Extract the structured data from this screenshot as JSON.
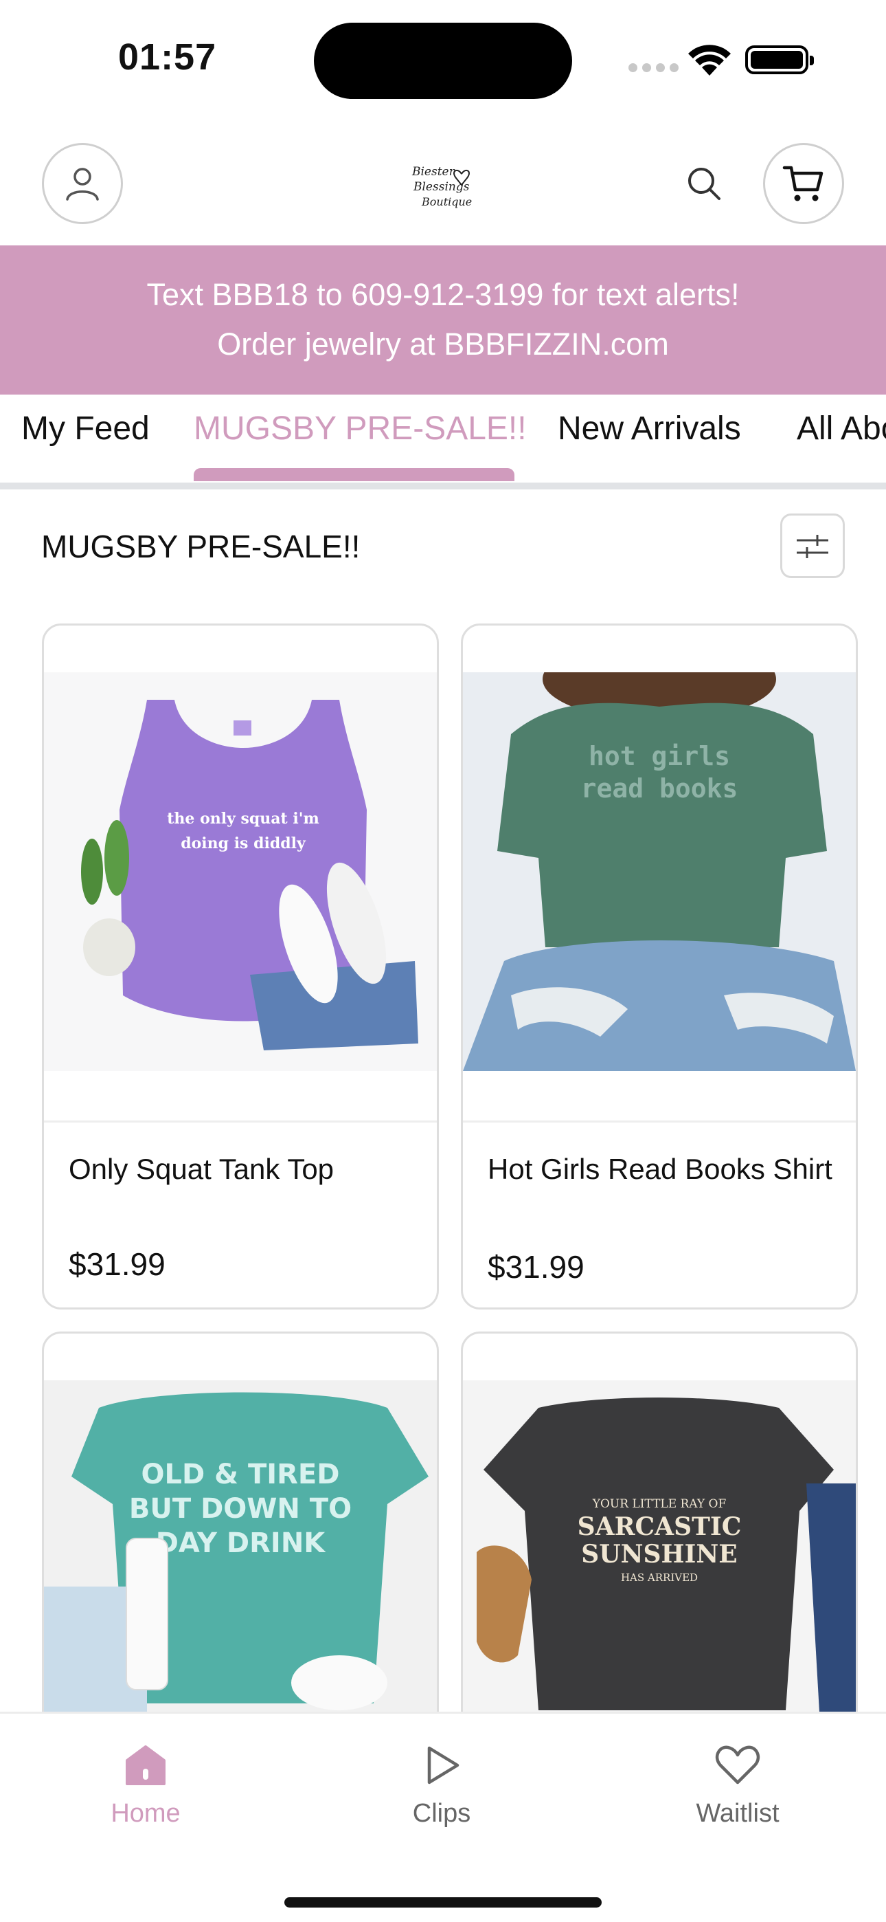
{
  "status_bar": {
    "time": "01:57"
  },
  "header": {
    "logo_alt": "Biester Blessings Boutique"
  },
  "banner": {
    "line1": "Text BBB18 to 609-912-3199 for text alerts!",
    "line2": "Order jewelry at BBBFIZZIN.com"
  },
  "tabs": [
    {
      "label": "My Feed"
    },
    {
      "label": "MUGSBY PRE-SALE!!"
    },
    {
      "label": "New Arrivals"
    },
    {
      "label": "All Abo"
    }
  ],
  "section": {
    "title": "MUGSBY PRE-SALE!!"
  },
  "products": [
    {
      "name": "Only Squat Tank Top",
      "price": "$31.99",
      "print": [
        "the only squat i'm",
        "doing is diddly"
      ]
    },
    {
      "name": "Hot Girls Read Books Shirt",
      "price": "$31.99",
      "print": [
        "hot girls",
        "read books"
      ]
    },
    {
      "name": "",
      "price": "",
      "print": [
        "OLD & TIRED",
        "BUT DOWN TO",
        "DAY DRINK"
      ]
    },
    {
      "name": "",
      "price": "",
      "print": [
        "YOUR LITTLE RAY OF",
        "SARCASTIC",
        "SUNSHINE",
        "HAS ARRIVED"
      ]
    }
  ],
  "bottom_nav": [
    {
      "label": "Home",
      "icon": "home-icon"
    },
    {
      "label": "Clips",
      "icon": "play-icon"
    },
    {
      "label": "Waitlist",
      "icon": "heart-icon"
    }
  ],
  "colors": {
    "accent": "#d09bbd",
    "border": "#dedede"
  }
}
